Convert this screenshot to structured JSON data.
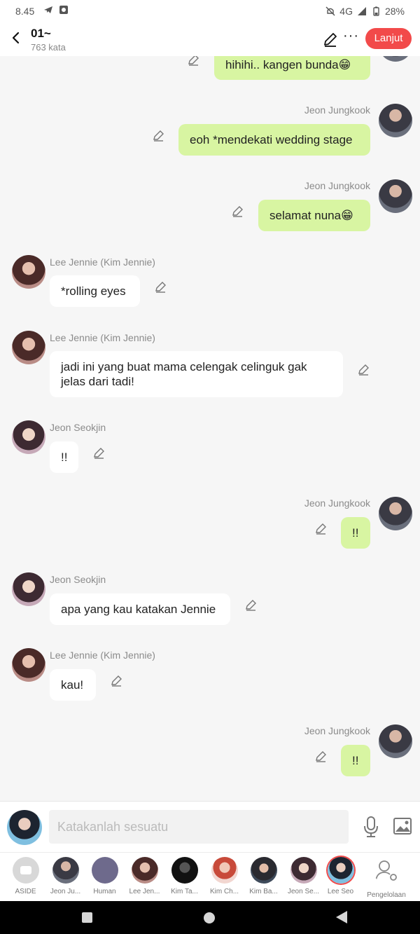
{
  "status_bar": {
    "time": "8.45",
    "network": "4G",
    "battery": "28%"
  },
  "header": {
    "title": "01~",
    "subtitle": "763 kata",
    "next_label": "Lanjut",
    "more_label": "···"
  },
  "messages": [
    {
      "side": "out",
      "sender": "",
      "text": "hihihi.. kangen bunda😁"
    },
    {
      "side": "out",
      "sender": "Jeon Jungkook",
      "text": "eoh *mendekati wedding stage"
    },
    {
      "side": "out",
      "sender": "Jeon Jungkook",
      "text": "selamat nuna😁"
    },
    {
      "side": "in",
      "sender": "Lee Jennie (Kim Jennie)",
      "text": "*rolling eyes"
    },
    {
      "side": "in",
      "sender": "Lee Jennie (Kim Jennie)",
      "text": "jadi ini yang buat mama celengak celinguk gak jelas dari tadi!"
    },
    {
      "side": "in",
      "sender": "Jeon Seokjin",
      "text": "!!"
    },
    {
      "side": "out",
      "sender": "Jeon Jungkook",
      "text": "!!"
    },
    {
      "side": "in",
      "sender": "Jeon Seokjin",
      "text": "apa yang kau katakan Jennie"
    },
    {
      "side": "in",
      "sender": "Lee Jennie (Kim Jennie)",
      "text": "kau!"
    },
    {
      "side": "out",
      "sender": "Jeon Jungkook",
      "text": "!!"
    }
  ],
  "input": {
    "placeholder": "Katakanlah sesuatu"
  },
  "characters": [
    {
      "label": "ASIDE"
    },
    {
      "label": "Jeon Ju..."
    },
    {
      "label": "Human"
    },
    {
      "label": "Lee Jen..."
    },
    {
      "label": "Kim Ta..."
    },
    {
      "label": "Kim Ch..."
    },
    {
      "label": "Kim Ba..."
    },
    {
      "label": "Jeon Se..."
    },
    {
      "label": "Lee Seo"
    },
    {
      "label": "Pengelolaan"
    }
  ],
  "colors": {
    "accent": "#f24a4a",
    "outgoing_bubble": "#d8f5a2",
    "incoming_bubble": "#ffffff",
    "background": "#f6f6f6"
  }
}
